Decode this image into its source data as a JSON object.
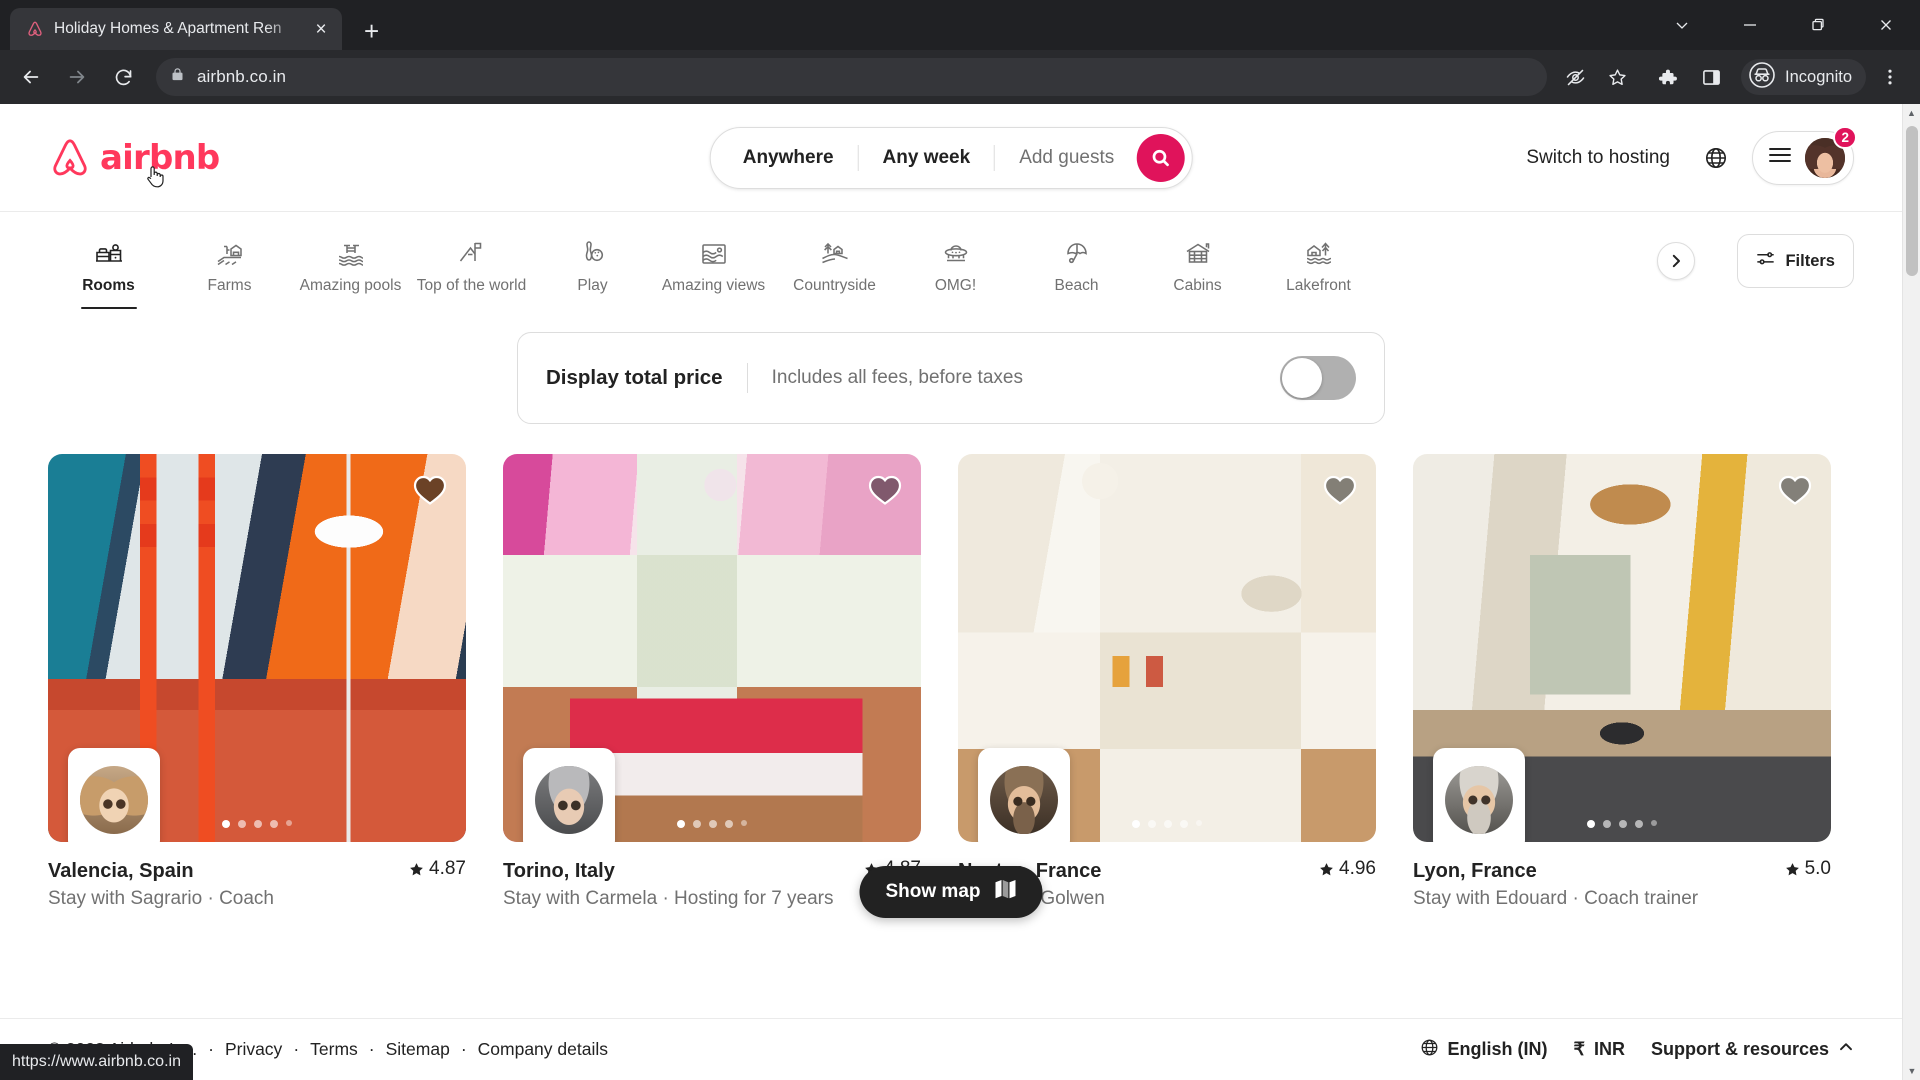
{
  "browser": {
    "tab": {
      "title": "Holiday Homes & Apartment Ren",
      "favicon": "airbnb-favicon",
      "close": "×"
    },
    "newtab_label": "+",
    "window_controls": [
      "chevron-down",
      "minimize",
      "restore",
      "close"
    ],
    "toolbar": {
      "back": "back-arrow",
      "forward": "forward-arrow",
      "reload": "reload-icon",
      "lock": "lock-icon",
      "url": "airbnb.co.in",
      "no_tracking": "eye-off-icon",
      "bookmark": "star-icon",
      "extensions": "puzzle-icon",
      "side_panel": "side-panel-icon",
      "incognito_label": "Incognito",
      "menu": "kebab-menu-icon"
    },
    "status_url": "https://www.airbnb.co.in"
  },
  "header": {
    "logo_text": "airbnb",
    "brand_color": "#FF385C",
    "search": {
      "location": "Anywhere",
      "dates": "Any week",
      "guests_placeholder": "Add guests",
      "search_icon": "search-icon",
      "search_btn_color": "#E0135B"
    },
    "switch_to_hosting": "Switch to hosting",
    "globe_icon": "globe-icon",
    "menu_icon": "hamburger-icon",
    "avatar": "user-avatar",
    "notification_count": "2"
  },
  "categories": {
    "items": [
      {
        "label": "Rooms",
        "icon": "bed-room-icon",
        "active": true
      },
      {
        "label": "Farms",
        "icon": "farm-icon",
        "active": false
      },
      {
        "label": "Amazing pools",
        "icon": "pool-icon",
        "active": false
      },
      {
        "label": "Top of the world",
        "icon": "mountain-flag-icon",
        "active": false
      },
      {
        "label": "Play",
        "icon": "bowling-icon",
        "active": false
      },
      {
        "label": "Amazing views",
        "icon": "view-icon",
        "active": false
      },
      {
        "label": "Countryside",
        "icon": "countryside-icon",
        "active": false
      },
      {
        "label": "OMG!",
        "icon": "ufo-icon",
        "active": false
      },
      {
        "label": "Beach",
        "icon": "umbrella-icon",
        "active": false
      },
      {
        "label": "Cabins",
        "icon": "cabin-icon",
        "active": false
      },
      {
        "label": "Lakefront",
        "icon": "lakefront-icon",
        "active": false
      }
    ],
    "next_arrow": "chevron-right-icon",
    "filters_label": "Filters",
    "filters_icon": "filter-sliders-icon"
  },
  "total_price_panel": {
    "title": "Display total price",
    "subtitle": "Includes all fees, before taxes",
    "toggle_state": "off"
  },
  "listings": [
    {
      "title": "Valencia, Spain",
      "subtitle": "Stay with Sagrario · Coach",
      "rating": "4.87",
      "star_icon": "star-icon",
      "favorited": true,
      "heart_icon": "heart-icon",
      "host_avatar": "host-avatar",
      "photo_index": 1,
      "photo_count": 5
    },
    {
      "title": "Torino, Italy",
      "subtitle": "Stay with Carmela · Hosting for 7 years",
      "rating": "4.87",
      "star_icon": "star-icon",
      "favorited": false,
      "heart_icon": "heart-icon",
      "host_avatar": "host-avatar",
      "photo_index": 1,
      "photo_count": 5
    },
    {
      "title": "Nantes, France",
      "subtitle": "Stay with Golwen",
      "rating": "4.96",
      "star_icon": "star-icon",
      "favorited": false,
      "heart_icon": "heart-icon",
      "host_avatar": "host-avatar",
      "photo_index": 1,
      "photo_count": 5
    },
    {
      "title": "Lyon, France",
      "subtitle": "Stay with Edouard · Coach trainer",
      "rating": "5.0",
      "star_icon": "star-icon",
      "favorited": false,
      "heart_icon": "heart-icon",
      "host_avatar": "host-avatar",
      "photo_index": 1,
      "photo_count": 5
    }
  ],
  "show_map": {
    "label": "Show map",
    "icon": "map-icon"
  },
  "footer": {
    "copyright": "© 2023 Airbnb, Inc.",
    "links": [
      "Privacy",
      "Terms",
      "Sitemap",
      "Company details"
    ],
    "separator": "·",
    "language": "English (IN)",
    "language_icon": "globe-icon",
    "currency_symbol": "₹",
    "currency": "INR",
    "support": "Support & resources",
    "support_chevron": "chevron-up-icon"
  }
}
